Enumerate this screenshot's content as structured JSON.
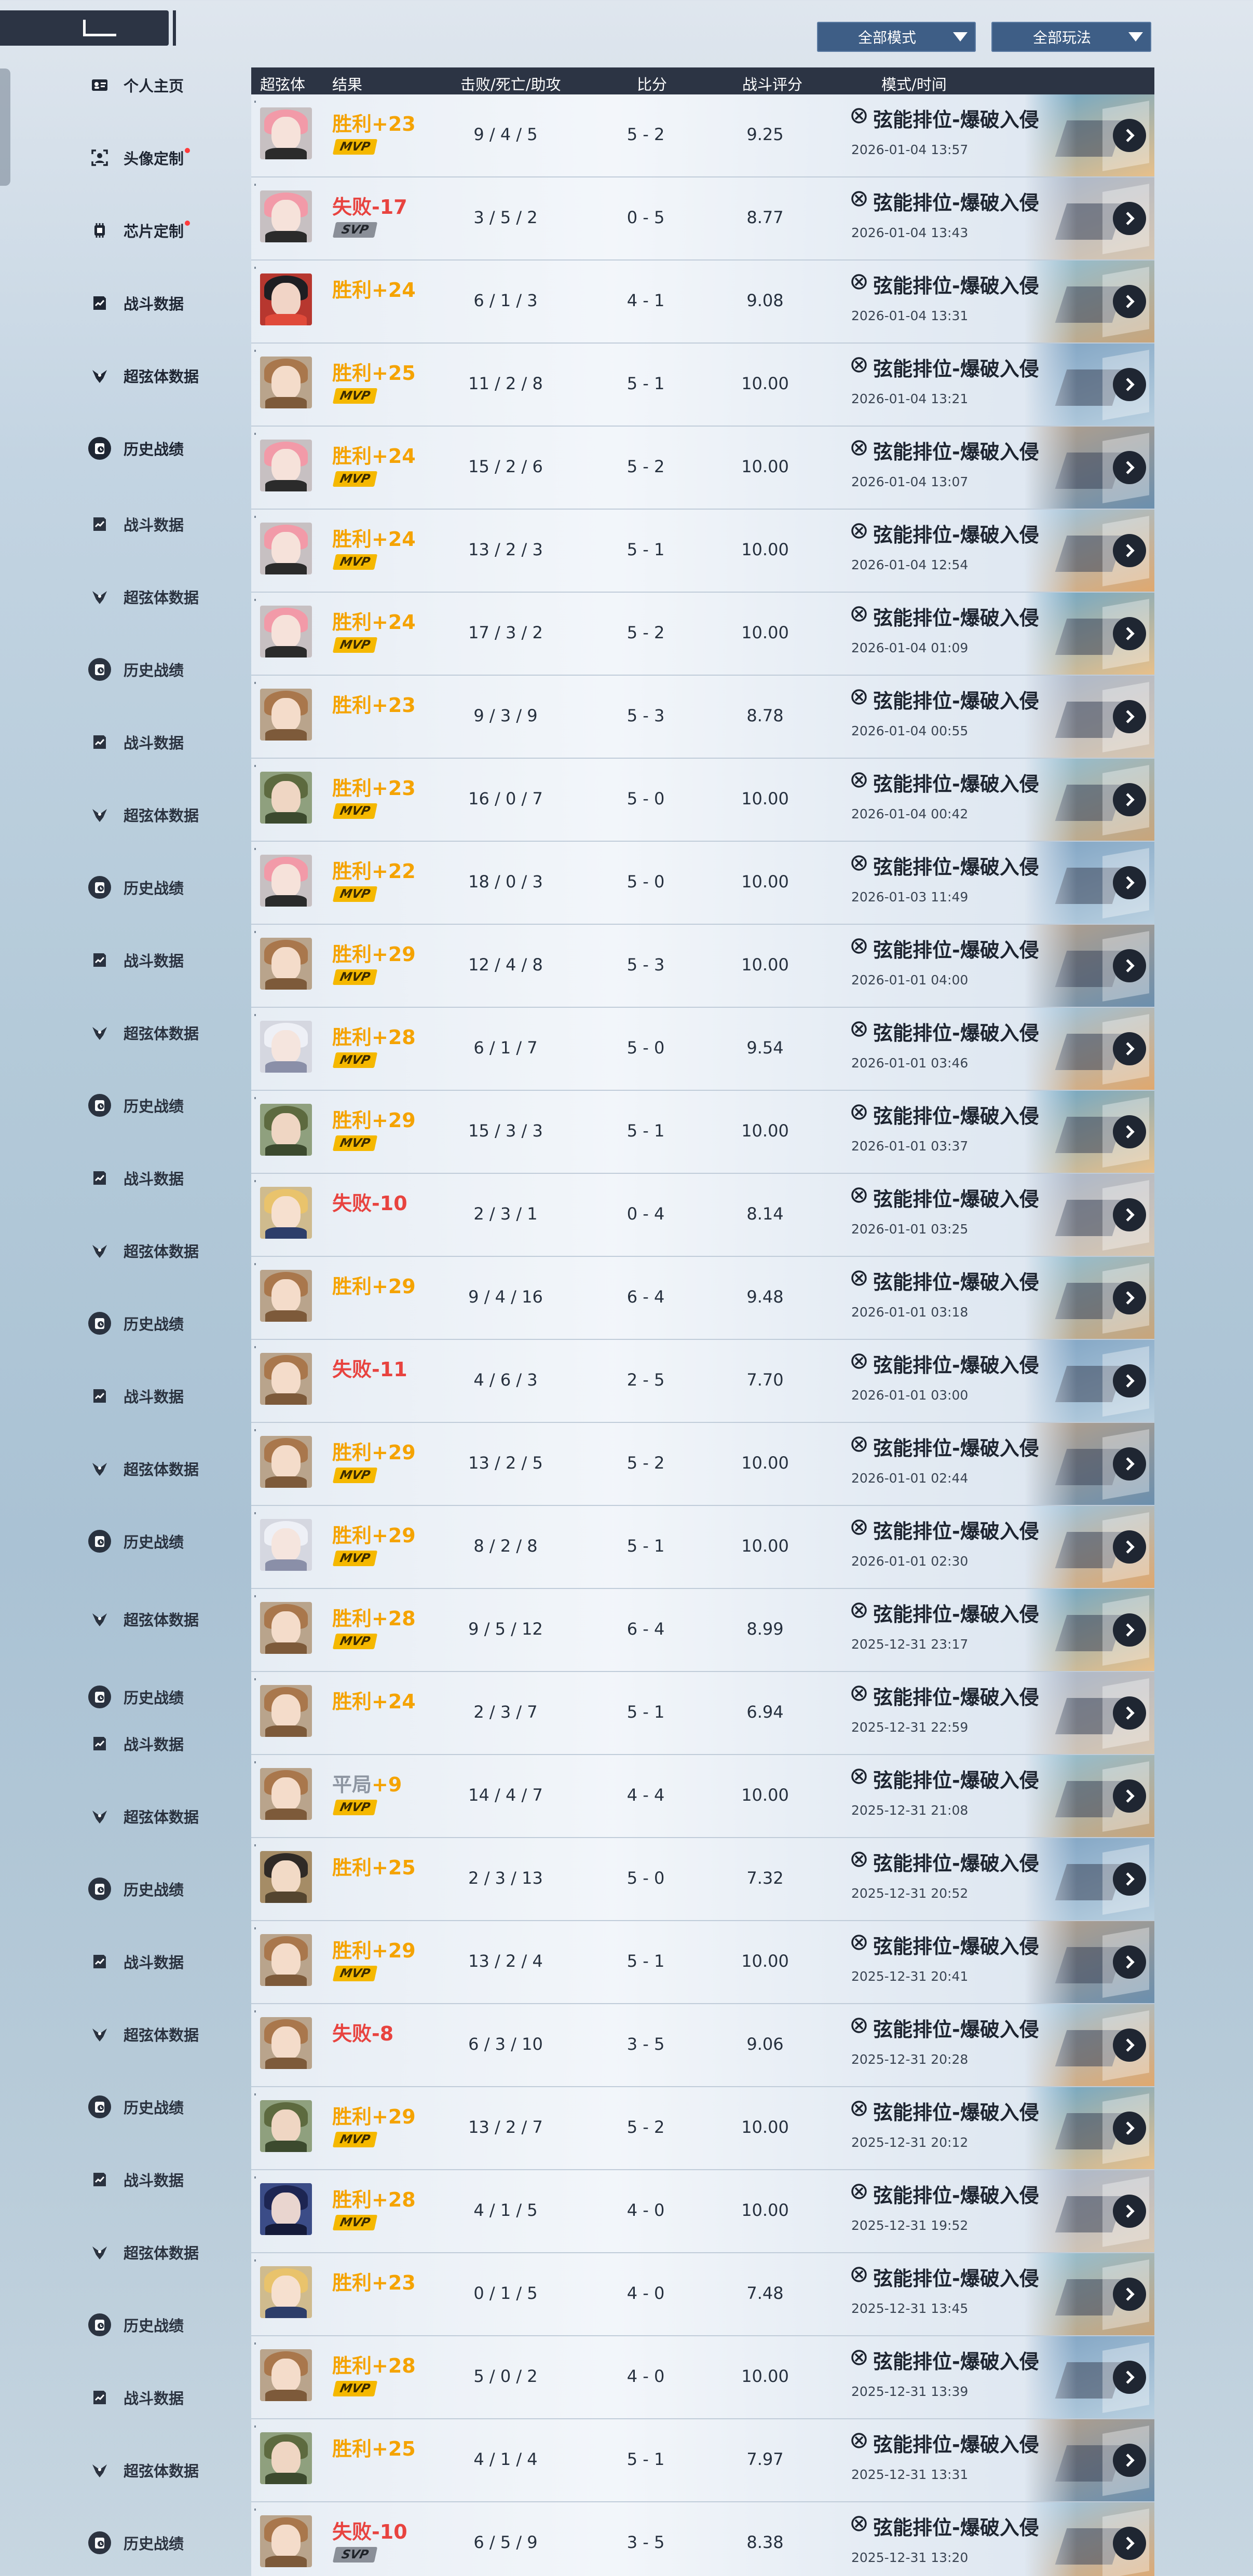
{
  "header": {
    "filter_mode_label": "全部模式",
    "filter_play_label": "全部玩法"
  },
  "sidebar": {
    "items": [
      {
        "label": "个人主页",
        "icon": "id-card-icon",
        "dot": false,
        "active": false
      },
      {
        "label": "头像定制",
        "icon": "avatar-frame-icon",
        "dot": true,
        "active": false
      },
      {
        "label": "芯片定制",
        "icon": "chip-icon",
        "dot": true,
        "active": false
      },
      {
        "label": "战斗数据",
        "icon": "battle-data-icon",
        "dot": false,
        "active": false
      },
      {
        "label": "超弦体数据",
        "icon": "character-data-icon",
        "dot": false,
        "active": false
      },
      {
        "label": "历史战绩",
        "icon": "history-icon",
        "dot": false,
        "active": true
      }
    ]
  },
  "ghost_menu": [
    {
      "label": "战斗数据",
      "icon": "battle-data-icon"
    },
    {
      "label": "超弦体数据",
      "icon": "character-data-icon"
    },
    {
      "label": "历史战绩",
      "icon": "history-icon"
    },
    {
      "label": "战斗数据",
      "icon": "battle-data-icon"
    },
    {
      "label": "超弦体数据",
      "icon": "character-data-icon"
    },
    {
      "label": "历史战绩",
      "icon": "history-icon"
    },
    {
      "label": "战斗数据",
      "icon": "battle-data-icon"
    },
    {
      "label": "超弦体数据",
      "icon": "character-data-icon"
    },
    {
      "label": "历史战绩",
      "icon": "history-icon"
    },
    {
      "label": "战斗数据",
      "icon": "battle-data-icon"
    },
    {
      "label": "超弦体数据",
      "icon": "character-data-icon"
    },
    {
      "label": "历史战绩",
      "icon": "history-icon"
    },
    {
      "label": "战斗数据",
      "icon": "battle-data-icon"
    },
    {
      "label": "超弦体数据",
      "icon": "character-data-icon"
    },
    {
      "label": "历史战绩",
      "icon": "history-icon"
    },
    {
      "label": "超弦体数据",
      "icon": "character-data-icon"
    },
    {
      "label": "历史战绩",
      "icon": "history-icon"
    },
    {
      "label": "战斗数据",
      "icon": "battle-data-icon"
    },
    {
      "label": "超弦体数据",
      "icon": "character-data-icon"
    },
    {
      "label": "历史战绩",
      "icon": "history-icon"
    },
    {
      "label": "战斗数据",
      "icon": "battle-data-icon"
    },
    {
      "label": "超弦体数据",
      "icon": "character-data-icon"
    },
    {
      "label": "历史战绩",
      "icon": "history-icon"
    },
    {
      "label": "战斗数据",
      "icon": "battle-data-icon"
    },
    {
      "label": "超弦体数据",
      "icon": "character-data-icon"
    },
    {
      "label": "历史战绩",
      "icon": "history-icon"
    },
    {
      "label": "战斗数据",
      "icon": "battle-data-icon"
    },
    {
      "label": "超弦体数据",
      "icon": "character-data-icon"
    },
    {
      "label": "历史战绩",
      "icon": "history-icon"
    }
  ],
  "table": {
    "columns": [
      "超弦体",
      "结果",
      "击败/死亡/助攻",
      "比分",
      "战斗评分",
      "模式/时间"
    ],
    "rows": [
      {
        "avatar": "pink",
        "result": "胜利",
        "delta": "+23",
        "type": "win",
        "badge": "MVP",
        "kda": "9 / 4 / 5",
        "score": "5 - 2",
        "rating": "9.25",
        "mode": "弦能排位-爆破入侵",
        "time": "2026-01-04 13:57"
      },
      {
        "avatar": "pink",
        "result": "失败",
        "delta": "-17",
        "type": "loss",
        "badge": "SVP",
        "kda": "3 / 5 / 2",
        "score": "0 - 5",
        "rating": "8.77",
        "mode": "弦能排位-爆破入侵",
        "time": "2026-01-04 13:43"
      },
      {
        "avatar": "red",
        "result": "胜利",
        "delta": "+24",
        "type": "win",
        "badge": "",
        "kda": "6 / 1 / 3",
        "score": "4 - 1",
        "rating": "9.08",
        "mode": "弦能排位-爆破入侵",
        "time": "2026-01-04 13:31"
      },
      {
        "avatar": "brown",
        "result": "胜利",
        "delta": "+25",
        "type": "win",
        "badge": "MVP",
        "kda": "11 / 2 / 8",
        "score": "5 - 1",
        "rating": "10.00",
        "mode": "弦能排位-爆破入侵",
        "time": "2026-01-04 13:21"
      },
      {
        "avatar": "pink",
        "result": "胜利",
        "delta": "+24",
        "type": "win",
        "badge": "MVP",
        "kda": "15 / 2 / 6",
        "score": "5 - 2",
        "rating": "10.00",
        "mode": "弦能排位-爆破入侵",
        "time": "2026-01-04 13:07"
      },
      {
        "avatar": "pink",
        "result": "胜利",
        "delta": "+24",
        "type": "win",
        "badge": "MVP",
        "kda": "13 / 2 / 3",
        "score": "5 - 1",
        "rating": "10.00",
        "mode": "弦能排位-爆破入侵",
        "time": "2026-01-04 12:54"
      },
      {
        "avatar": "pink",
        "result": "胜利",
        "delta": "+24",
        "type": "win",
        "badge": "MVP",
        "kda": "17 / 3 / 2",
        "score": "5 - 2",
        "rating": "10.00",
        "mode": "弦能排位-爆破入侵",
        "time": "2026-01-04 01:09"
      },
      {
        "avatar": "brown",
        "result": "胜利",
        "delta": "+23",
        "type": "win",
        "badge": "",
        "kda": "9 / 3 / 9",
        "score": "5 - 3",
        "rating": "8.78",
        "mode": "弦能排位-爆破入侵",
        "time": "2026-01-04 00:55"
      },
      {
        "avatar": "green",
        "result": "胜利",
        "delta": "+23",
        "type": "win",
        "badge": "MVP",
        "kda": "16 / 0 / 7",
        "score": "5 - 0",
        "rating": "10.00",
        "mode": "弦能排位-爆破入侵",
        "time": "2026-01-04 00:42"
      },
      {
        "avatar": "pink",
        "result": "胜利",
        "delta": "+22",
        "type": "win",
        "badge": "MVP",
        "kda": "18 / 0 / 3",
        "score": "5 - 0",
        "rating": "10.00",
        "mode": "弦能排位-爆破入侵",
        "time": "2026-01-03 11:49"
      },
      {
        "avatar": "brown",
        "result": "胜利",
        "delta": "+29",
        "type": "win",
        "badge": "MVP",
        "kda": "12 / 4 / 8",
        "score": "5 - 3",
        "rating": "10.00",
        "mode": "弦能排位-爆破入侵",
        "time": "2026-01-01 04:00"
      },
      {
        "avatar": "white",
        "result": "胜利",
        "delta": "+28",
        "type": "win",
        "badge": "MVP",
        "kda": "6 / 1 / 7",
        "score": "5 - 0",
        "rating": "9.54",
        "mode": "弦能排位-爆破入侵",
        "time": "2026-01-01 03:46"
      },
      {
        "avatar": "green",
        "result": "胜利",
        "delta": "+29",
        "type": "win",
        "badge": "MVP",
        "kda": "15 / 3 / 3",
        "score": "5 - 1",
        "rating": "10.00",
        "mode": "弦能排位-爆破入侵",
        "time": "2026-01-01 03:37"
      },
      {
        "avatar": "blonde",
        "result": "失败",
        "delta": "-10",
        "type": "loss",
        "badge": "",
        "kda": "2 / 3 / 1",
        "score": "0 - 4",
        "rating": "8.14",
        "mode": "弦能排位-爆破入侵",
        "time": "2026-01-01 03:25"
      },
      {
        "avatar": "brown",
        "result": "胜利",
        "delta": "+29",
        "type": "win",
        "badge": "",
        "kda": "9 / 4 / 16",
        "score": "6 - 4",
        "rating": "9.48",
        "mode": "弦能排位-爆破入侵",
        "time": "2026-01-01 03:18"
      },
      {
        "avatar": "brown",
        "result": "失败",
        "delta": "-11",
        "type": "loss",
        "badge": "",
        "kda": "4 / 6 / 3",
        "score": "2 - 5",
        "rating": "7.70",
        "mode": "弦能排位-爆破入侵",
        "time": "2026-01-01 03:00"
      },
      {
        "avatar": "brown",
        "result": "胜利",
        "delta": "+29",
        "type": "win",
        "badge": "MVP",
        "kda": "13 / 2 / 5",
        "score": "5 - 2",
        "rating": "10.00",
        "mode": "弦能排位-爆破入侵",
        "time": "2026-01-01 02:44"
      },
      {
        "avatar": "white",
        "result": "胜利",
        "delta": "+29",
        "type": "win",
        "badge": "MVP",
        "kda": "8 / 2 / 8",
        "score": "5 - 1",
        "rating": "10.00",
        "mode": "弦能排位-爆破入侵",
        "time": "2026-01-01 02:30"
      },
      {
        "avatar": "brown",
        "result": "胜利",
        "delta": "+28",
        "type": "win",
        "badge": "MVP",
        "kda": "9 / 5 / 12",
        "score": "6 - 4",
        "rating": "8.99",
        "mode": "弦能排位-爆破入侵",
        "time": "2025-12-31 23:17"
      },
      {
        "avatar": "brown",
        "result": "胜利",
        "delta": "+24",
        "type": "win",
        "badge": "",
        "kda": "2 / 3 / 7",
        "score": "5 - 1",
        "rating": "6.94",
        "mode": "弦能排位-爆破入侵",
        "time": "2025-12-31 22:59"
      },
      {
        "avatar": "brown",
        "result": "平局",
        "delta": "+9",
        "type": "draw",
        "badge": "MVP",
        "kda": "14 / 4 / 7",
        "score": "4 - 4",
        "rating": "10.00",
        "mode": "弦能排位-爆破入侵",
        "time": "2025-12-31 21:08"
      },
      {
        "avatar": "hat",
        "result": "胜利",
        "delta": "+25",
        "type": "win",
        "badge": "",
        "kda": "2 / 3 / 13",
        "score": "5 - 0",
        "rating": "7.32",
        "mode": "弦能排位-爆破入侵",
        "time": "2025-12-31 20:52"
      },
      {
        "avatar": "brown",
        "result": "胜利",
        "delta": "+29",
        "type": "win",
        "badge": "MVP",
        "kda": "13 / 2 / 4",
        "score": "5 - 1",
        "rating": "10.00",
        "mode": "弦能排位-爆破入侵",
        "time": "2025-12-31 20:41"
      },
      {
        "avatar": "brown",
        "result": "失败",
        "delta": "-8",
        "type": "loss",
        "badge": "",
        "kda": "6 / 3 / 10",
        "score": "3 - 5",
        "rating": "9.06",
        "mode": "弦能排位-爆破入侵",
        "time": "2025-12-31 20:28"
      },
      {
        "avatar": "green",
        "result": "胜利",
        "delta": "+29",
        "type": "win",
        "badge": "MVP",
        "kda": "13 / 2 / 7",
        "score": "5 - 2",
        "rating": "10.00",
        "mode": "弦能排位-爆破入侵",
        "time": "2025-12-31 20:12"
      },
      {
        "avatar": "navy",
        "result": "胜利",
        "delta": "+28",
        "type": "win",
        "badge": "MVP",
        "kda": "4 / 1 / 5",
        "score": "4 - 0",
        "rating": "10.00",
        "mode": "弦能排位-爆破入侵",
        "time": "2025-12-31 19:52"
      },
      {
        "avatar": "blonde",
        "result": "胜利",
        "delta": "+23",
        "type": "win",
        "badge": "",
        "kda": "0 / 1 / 5",
        "score": "4 - 0",
        "rating": "7.48",
        "mode": "弦能排位-爆破入侵",
        "time": "2025-12-31 13:45"
      },
      {
        "avatar": "brown",
        "result": "胜利",
        "delta": "+28",
        "type": "win",
        "badge": "MVP",
        "kda": "5 / 0 / 2",
        "score": "4 - 0",
        "rating": "10.00",
        "mode": "弦能排位-爆破入侵",
        "time": "2025-12-31 13:39"
      },
      {
        "avatar": "green",
        "result": "胜利",
        "delta": "+25",
        "type": "win",
        "badge": "",
        "kda": "4 / 1 / 4",
        "score": "5 - 1",
        "rating": "7.97",
        "mode": "弦能排位-爆破入侵",
        "time": "2025-12-31 13:31"
      },
      {
        "avatar": "brown",
        "result": "失败",
        "delta": "-10",
        "type": "loss",
        "badge": "SVP",
        "kda": "6 / 5 / 9",
        "score": "3 - 5",
        "rating": "8.38",
        "mode": "弦能排位-爆破入侵",
        "time": "2025-12-31 13:20"
      }
    ]
  },
  "colors": {
    "win": "#f5a300",
    "loss": "#e8433f",
    "draw_label": "#8e96a2",
    "header_bg": "#2c3444",
    "dropdown_bg": "#3e5e86"
  }
}
